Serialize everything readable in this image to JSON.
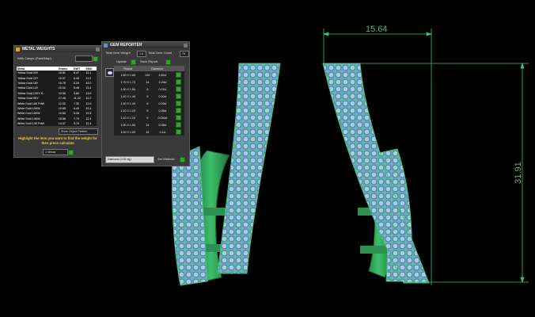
{
  "dimensions": {
    "width_label": "15.64",
    "height_label": "31.91"
  },
  "metal_weights": {
    "title": "METAL WEIGHTS",
    "subtitle": "With Clasps (Pack/Map)",
    "columns": [
      "Metal",
      "Grams",
      "DWT",
      "SMO"
    ],
    "rows": [
      [
        "Yellow Gold 24Y",
        "10.81",
        "6.47",
        "12.1"
      ],
      [
        "Yellow Gold 22Y",
        "10.07",
        "6.49",
        "11.9"
      ],
      [
        "Yellow Gold 18Y",
        "10.76",
        "6.09",
        "12.0"
      ],
      [
        "Yellow Gold 14Y",
        "10.02",
        "5.48",
        "13.4"
      ],
      [
        "Yellow Gold 10KY R..",
        "10.55",
        "5.60",
        "13.6"
      ],
      [
        "Yellow Gold 9KY",
        "17.45",
        "11.22",
        "12.2"
      ],
      [
        "White Gold 18K PdW",
        "12.02",
        "7.30",
        "12.0"
      ],
      [
        "White Gold 10KW",
        "10.65",
        "6.40",
        "12.4"
      ],
      [
        "White Gold 18KW",
        "10.80",
        "6.08",
        "12.8"
      ],
      [
        "White Gold 14KW",
        "10.88",
        "7.70",
        "12.4"
      ],
      [
        "White Gold 14K PdW",
        "14.07",
        "9.70",
        "12.4"
      ]
    ],
    "button_label": "Show Object Pattern",
    "note": "Highlight the item you want to find the weight for then press calculate",
    "dropdown_value": "1 Virtual"
  },
  "gem_reporter": {
    "title": "GEM REPORTER",
    "total_weight_label": "Total Gem Weight",
    "total_weight_value": "1.8",
    "total_count_label": "Total Gem Count",
    "total_count_value": "7b",
    "update_label": "Update",
    "save_label": "Save Report",
    "columns": [
      "Round",
      "Diamond"
    ],
    "rows": [
      [
        "1.80 X 1.80",
        "130",
        "2.62ct"
      ],
      [
        "1.70 X 1.70",
        "14",
        "2.29ct"
      ],
      [
        "1.50 X 1.50",
        "8",
        "0.07ct"
      ],
      [
        "1.40 X 1.40",
        "8",
        "0.10ct"
      ],
      [
        "1.40 X 1.40",
        "8",
        "0.09ct"
      ],
      [
        "1.10 X 1.10",
        "6",
        "0.05ct"
      ],
      [
        "1.10 X 1.10",
        "6",
        "0.030ct"
      ],
      [
        "1.00 X 1.00",
        "14",
        "0.08ct"
      ],
      [
        "1.00 X 1.00",
        "16",
        "0.1ct"
      ]
    ],
    "material_value": "Diamond (3.52 sg)",
    "set_material_label": "Set Material"
  },
  "colors": {
    "wire_green": "#3fbf6f",
    "gem_blue": "#8fb8ef",
    "metal_green": "#2f9e58",
    "note_yellow": "#f0d020"
  },
  "icons": [
    "gem-icon",
    "metal-icon",
    "checkmark-icon",
    "close-icon"
  ]
}
